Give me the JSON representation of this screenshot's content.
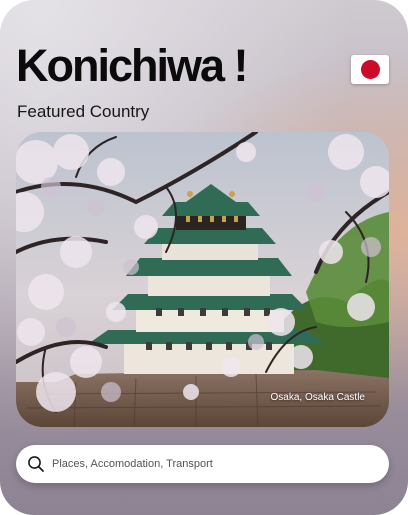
{
  "header": {
    "greeting": "Konichiwa !",
    "flag_icon": "japan-flag-icon",
    "flag_color": "#cc0a2a"
  },
  "featured": {
    "label": "Featured Country",
    "caption": "Osaka, Osaka Castle"
  },
  "search": {
    "placeholder": "Places, Accomodation, Transport",
    "icon": "search-icon"
  },
  "colors": {
    "background_accent": "#e8b59a",
    "card_text": "#0b0b0b"
  }
}
